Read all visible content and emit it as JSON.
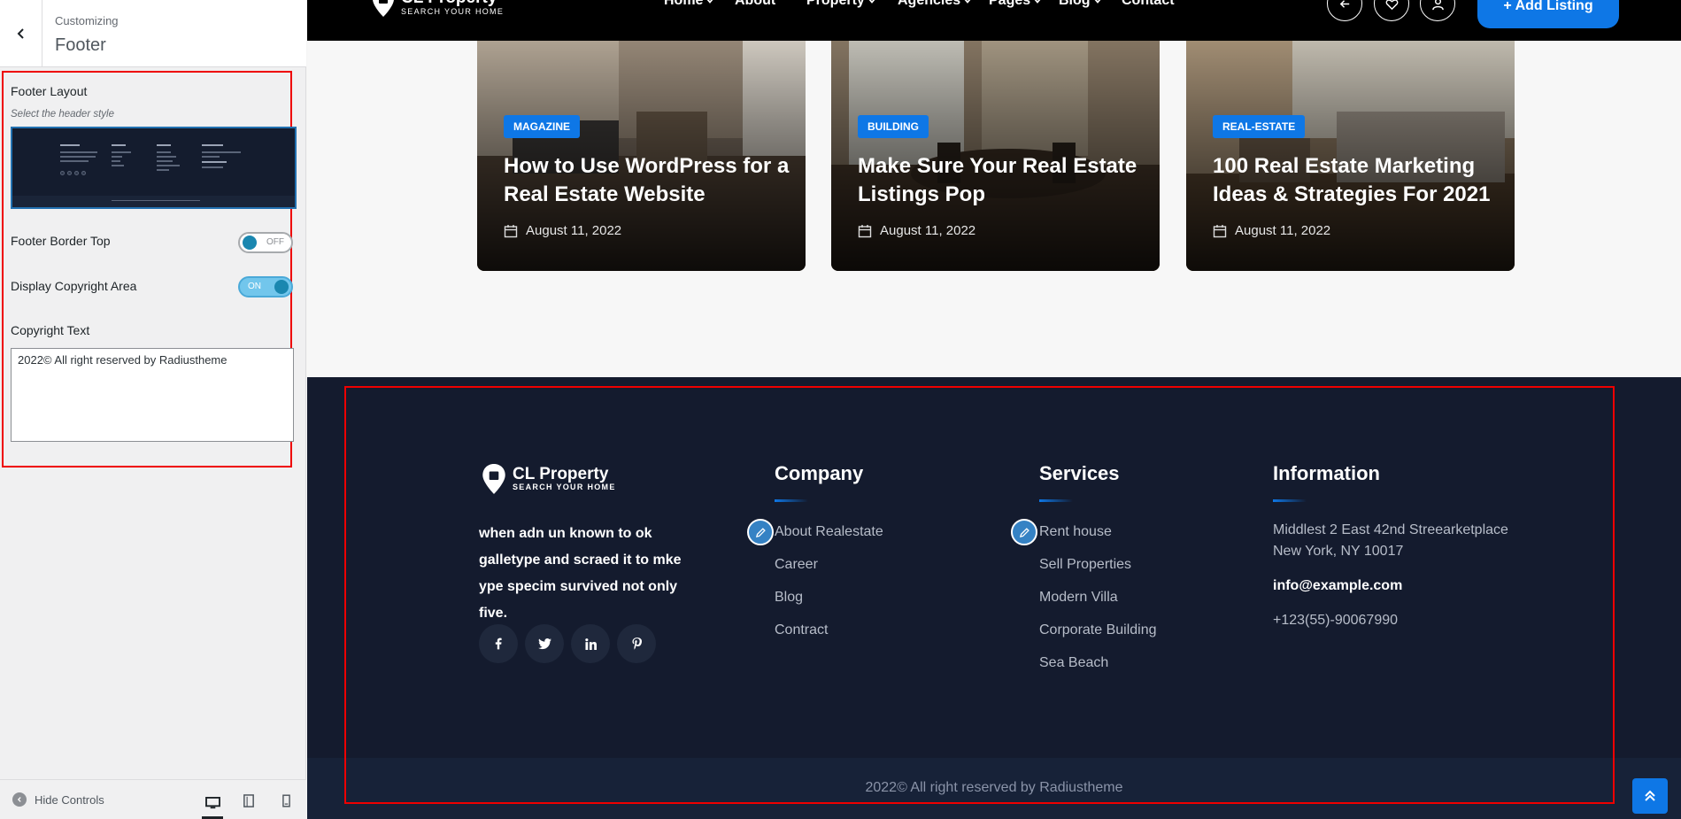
{
  "customizer": {
    "breadcrumb": "Customizing",
    "title": "Footer",
    "footer_layout_label": "Footer Layout",
    "footer_layout_desc": "Select the header style",
    "border_top_label": "Footer Border Top",
    "border_top_state": "OFF",
    "copyright_area_label": "Display Copyright Area",
    "copyright_area_state": "ON",
    "copyright_text_label": "Copyright Text",
    "copyright_text_value": "2022© All right reserved by Radiustheme",
    "hide_controls": "Hide Controls"
  },
  "site": {
    "logo": {
      "name": "CL Property",
      "tagline": "SEARCH YOUR HOME"
    },
    "nav": [
      "Home",
      "About",
      "Property",
      "Agencies",
      "Pages",
      "Blog",
      "Contact"
    ],
    "add_listing": "+ Add Listing",
    "posts": [
      {
        "category": "MAGAZINE",
        "title": "How to Use WordPress for a Real Estate Website",
        "date": "August 11, 2022"
      },
      {
        "category": "BUILDING",
        "title": "Make Sure Your Real Estate Listings Pop",
        "date": "August 11, 2022"
      },
      {
        "category": "REAL-ESTATE",
        "title": "100 Real Estate Marketing Ideas & Strategies For 2021",
        "date": "August 11, 2022"
      }
    ],
    "footer": {
      "description": "when adn un known to ok galletype and scraed it to mke ype specim survived not only five.",
      "social": [
        "facebook",
        "twitter",
        "linkedin",
        "pinterest"
      ],
      "company": {
        "title": "Company",
        "links": [
          "About Realestate",
          "Career",
          "Blog",
          "Contract"
        ]
      },
      "services": {
        "title": "Services",
        "links": [
          "Rent house",
          "Sell Properties",
          "Modern Villa",
          "Corporate Building",
          "Sea Beach"
        ]
      },
      "information": {
        "title": "Information",
        "address_line1": "Middlest 2 East 42nd Streearketplace",
        "address_line2": "New York, NY 10017",
        "email": "info@example.com",
        "phone": "+123(55)-90067990"
      },
      "copyright": "2022© All right reserved by Radiustheme"
    },
    "colors": {
      "accent": "#0e77e6",
      "footer_bg": "#141b2e",
      "highlight": "#ee0000"
    }
  }
}
